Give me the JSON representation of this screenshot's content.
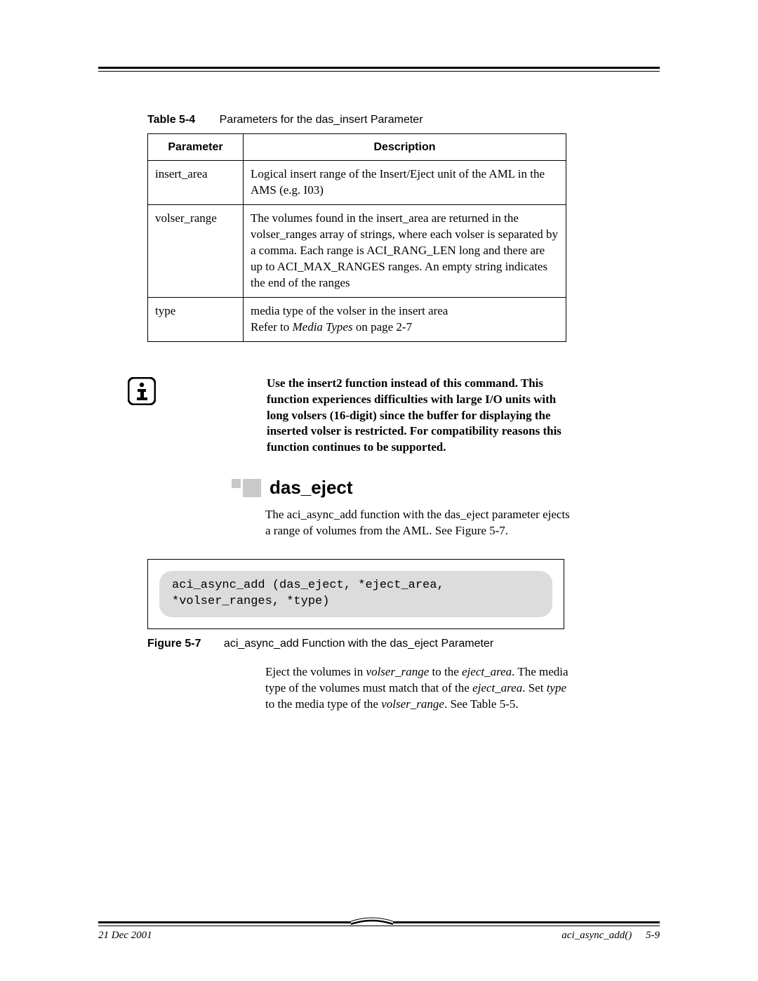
{
  "table": {
    "label": "Table 5-4",
    "caption": "Parameters for the das_insert Parameter",
    "head_param": "Parameter",
    "head_desc": "Description",
    "rows": [
      {
        "param": "insert_area",
        "desc": "Logical insert range of the Insert/Eject unit of the AML in the AMS (e.g. I03)"
      },
      {
        "param": "volser_range",
        "desc": "The volumes found in the insert_area are returned in the volser_ranges array of strings, where each volser is separated by a comma. Each range is ACI_RANG_LEN long and there are up to ACI_MAX_RANGES ranges. An empty string indicates the end of the ranges"
      },
      {
        "param": "type",
        "desc_prefix": "media type of the volser in the insert area",
        "desc_refer": "Refer to ",
        "desc_ref_ital": "Media Types",
        "desc_ref_tail": " on page 2-7"
      }
    ]
  },
  "note": "Use the insert2 function instead of this command. This function experiences difficulties with large I/O units with long volsers (16-digit) since the buffer for displaying the inserted volser is restricted. For compatibility reasons this function continues to be supported.",
  "section_heading": "das_eject",
  "section_intro": "The aci_async_add function with the das_eject parameter ejects a range of volumes from the AML. See Figure 5-7.",
  "code": "aci_async_add (das_eject, *eject_area, *volser_ranges, *type)",
  "figure": {
    "label": "Figure 5-7",
    "caption": "aci_async_add Function with the das_eject Parameter"
  },
  "after_fig_p1_a": "Eject the volumes in ",
  "after_fig_p1_i1": "volser_range",
  "after_fig_p1_b": " to the ",
  "after_fig_p1_i2": "eject_area",
  "after_fig_p1_c": ". The media type of the volumes must match that of the ",
  "after_fig_p1_i3": "eject_area",
  "after_fig_p1_d": ". Set ",
  "after_fig_p1_i4": "type",
  "after_fig_p1_e": " to the media type of the ",
  "after_fig_p1_i5": "volser_range",
  "after_fig_p1_f": ". See Table 5-5.",
  "footer": {
    "date": "21 Dec 2001",
    "section": "aci_async_add()",
    "page": "5-9"
  }
}
